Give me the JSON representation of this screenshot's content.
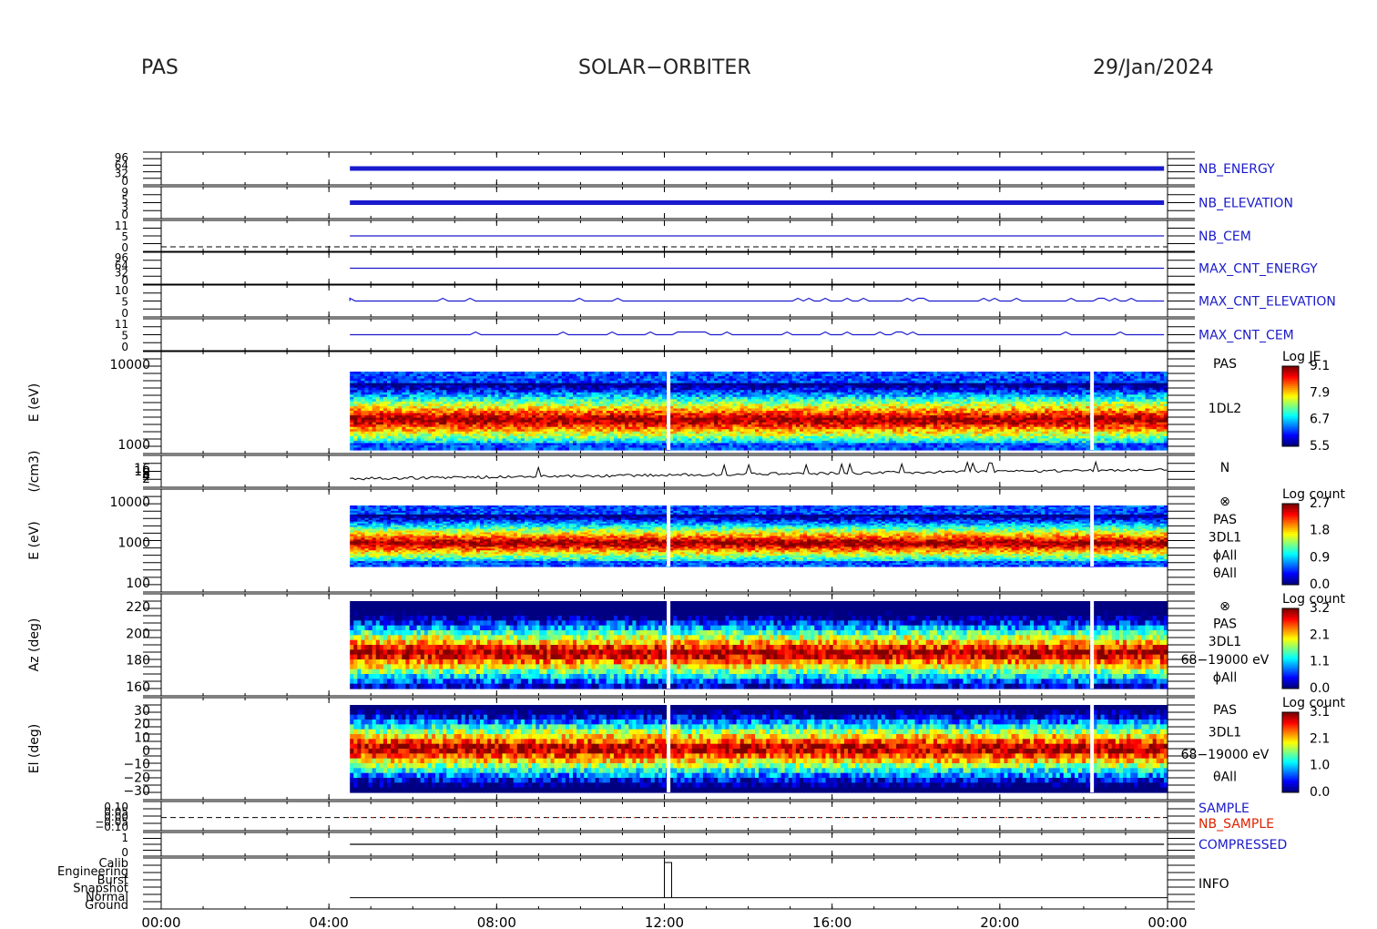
{
  "header": {
    "instrument": "PAS",
    "mission": "SOLAR−ORBITER",
    "date": "29/Jan/2024"
  },
  "colors": {
    "blue": "#1a1acc",
    "red": "#dd2200",
    "black": "#000000"
  },
  "chart_data": {
    "type": "heatmap",
    "x_ticks": [
      "00:00",
      "04:00",
      "08:00",
      "12:00",
      "16:00",
      "20:00",
      "00:00"
    ],
    "data_start_hour": 4.5,
    "gap_hours": [
      12.1,
      22.2
    ],
    "panels": [
      {
        "id": "nb_energy",
        "kind": "hk",
        "right_label": "NB_ENERGY",
        "label_color": "blue",
        "tick_labels": [
          "96",
          "64",
          "32",
          "0"
        ]
      },
      {
        "id": "nb_elevation",
        "kind": "hk",
        "right_label": "NB_ELEVATION",
        "label_color": "blue",
        "tick_labels": [
          "9",
          "5",
          "3",
          "0"
        ]
      },
      {
        "id": "nb_cem",
        "kind": "hk",
        "right_label": "NB_CEM",
        "label_color": "blue",
        "tick_labels": [
          "11",
          "5",
          "0"
        ]
      },
      {
        "id": "max_cnt_energy",
        "kind": "hk",
        "right_label": "MAX_CNT_ENERGY",
        "label_color": "blue",
        "tick_labels": [
          "96",
          "64",
          "32",
          "0"
        ]
      },
      {
        "id": "max_cnt_elevation",
        "kind": "hk",
        "right_label": "MAX_CNT_ELEVATION",
        "label_color": "blue",
        "tick_labels": [
          "10",
          "5",
          "0"
        ]
      },
      {
        "id": "max_cnt_cem",
        "kind": "hk",
        "right_label": "MAX_CNT_CEM",
        "label_color": "blue",
        "tick_labels": [
          "11",
          "5",
          "0"
        ]
      },
      {
        "id": "spec_1dl2",
        "kind": "spectrogram",
        "ylabel": "E (eV)",
        "yticks": [
          "10000",
          "1000"
        ],
        "side_labels": [
          "PAS",
          "1DL2"
        ],
        "colorbar": {
          "title": "Log JE",
          "ticks": [
            "9.1",
            "7.9",
            "6.7",
            "5.5"
          ]
        }
      },
      {
        "id": "density",
        "kind": "density",
        "ylabel": "(/cm3)",
        "yticks": [
          "16",
          "10",
          "8",
          "4",
          "2"
        ],
        "side_labels": [
          "N"
        ]
      },
      {
        "id": "spec_3dl1",
        "kind": "spectrogram",
        "ylabel": "E (eV)",
        "yticks": [
          "10000",
          "1000",
          "100"
        ],
        "side_labels": [
          "⊗",
          "PAS",
          "3DL1",
          "ϕAll",
          "θAll"
        ],
        "colorbar": {
          "title": "Log count",
          "ticks": [
            "2.7",
            "1.8",
            "0.9",
            "0.0"
          ]
        }
      },
      {
        "id": "azimuth",
        "kind": "angle",
        "ylabel": "Az (deg)",
        "yticks": [
          "220",
          "200",
          "180",
          "160"
        ],
        "side_labels": [
          "⊗",
          "PAS",
          "3DL1",
          "68−19000 eV",
          "ϕAll"
        ],
        "colorbar": {
          "title": "Log count",
          "ticks": [
            "3.2",
            "2.1",
            "1.1",
            "0.0"
          ]
        }
      },
      {
        "id": "elevation",
        "kind": "angle",
        "ylabel": "El (deg)",
        "yticks": [
          "30",
          "20",
          "10",
          "0",
          "−10",
          "−20",
          "−30"
        ],
        "side_labels": [
          "PAS",
          "3DL1",
          "68−19000 eV",
          "θAll"
        ],
        "colorbar": {
          "title": "Log count",
          "ticks": [
            "3.1",
            "2.1",
            "1.0",
            "0.0"
          ]
        }
      },
      {
        "id": "sample",
        "kind": "hk2",
        "right_labels": [
          {
            "text": "SAMPLE",
            "color": "blue"
          },
          {
            "text": "NB_SAMPLE",
            "color": "red"
          }
        ],
        "tick_labels": [
          "0.10",
          "0.05",
          "0.00",
          "−0.05",
          "−0.10"
        ]
      },
      {
        "id": "compressed",
        "kind": "flag",
        "right_label": "COMPRESSED",
        "label_color": "blue",
        "tick_labels": [
          "1",
          "0"
        ]
      },
      {
        "id": "info",
        "kind": "info",
        "right_label": "INFO",
        "label_color": "black",
        "tick_labels": [
          "Calib",
          "Engineering",
          "Burst",
          "Snapshot",
          "Normal",
          "Ground"
        ]
      }
    ]
  }
}
